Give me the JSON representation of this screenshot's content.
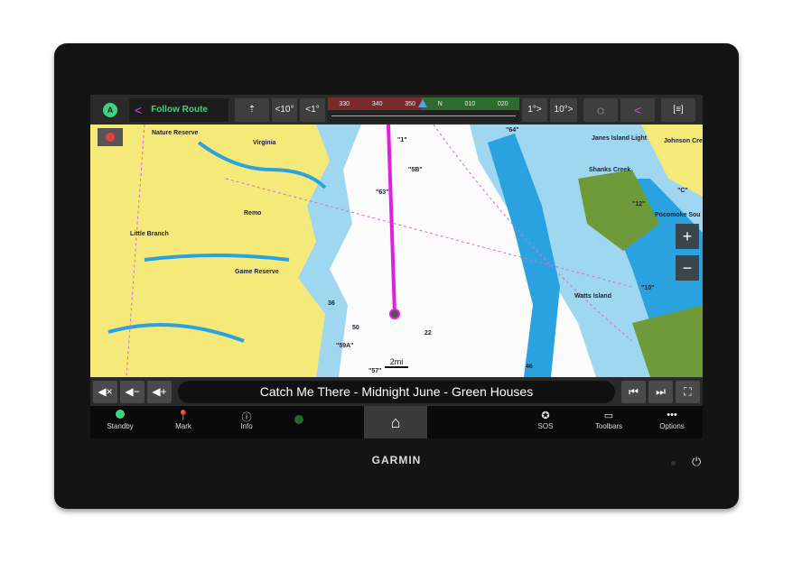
{
  "topbar": {
    "autopilot_icon": "A",
    "mode_label": "Follow Route",
    "heading_up": "⇡",
    "minus10": "<10°",
    "minus1": "<1°",
    "plus1": "1°>",
    "plus10": "10°>",
    "compass_ticks": [
      "330",
      "340",
      "350",
      "N",
      "010",
      "020"
    ]
  },
  "map": {
    "labels": [
      "Nature Reserve",
      "Virginia",
      "Remo",
      "Little Branch",
      "Game Reserve",
      "Shanks Creek",
      "Janes Island Light",
      "Johnson Cre",
      "Pocomoke Sou",
      "Watts Island",
      "\"64\"",
      "\"5B\"",
      "\"63\"",
      "\"1\"",
      "\"57\"",
      "\"59A\"",
      "\"10\"",
      "\"12\"",
      "\"C\"",
      "50",
      "36",
      "22",
      "46"
    ],
    "scale": "2mi",
    "zoom_in": "+",
    "zoom_out": "−"
  },
  "media": {
    "mute": "◀×",
    "vol_down": "◀−",
    "vol_up": "◀+",
    "now_playing": "Catch Me There - Midnight June - Green Houses",
    "prev": "⏮",
    "next": "⏭",
    "fullscreen": "⛶"
  },
  "nav": {
    "standby": "Standby",
    "mark": "Mark",
    "info": "Info",
    "sos": "SOS",
    "toolbars": "Toolbars",
    "options": "Options"
  },
  "brand": "GARMIN",
  "colors": {
    "land": "#f5e97a",
    "water_shallow": "#9fd6f0",
    "water_deep": "#2aa2e0",
    "route": "#e020e0",
    "accent_green": "#3fd47b"
  }
}
